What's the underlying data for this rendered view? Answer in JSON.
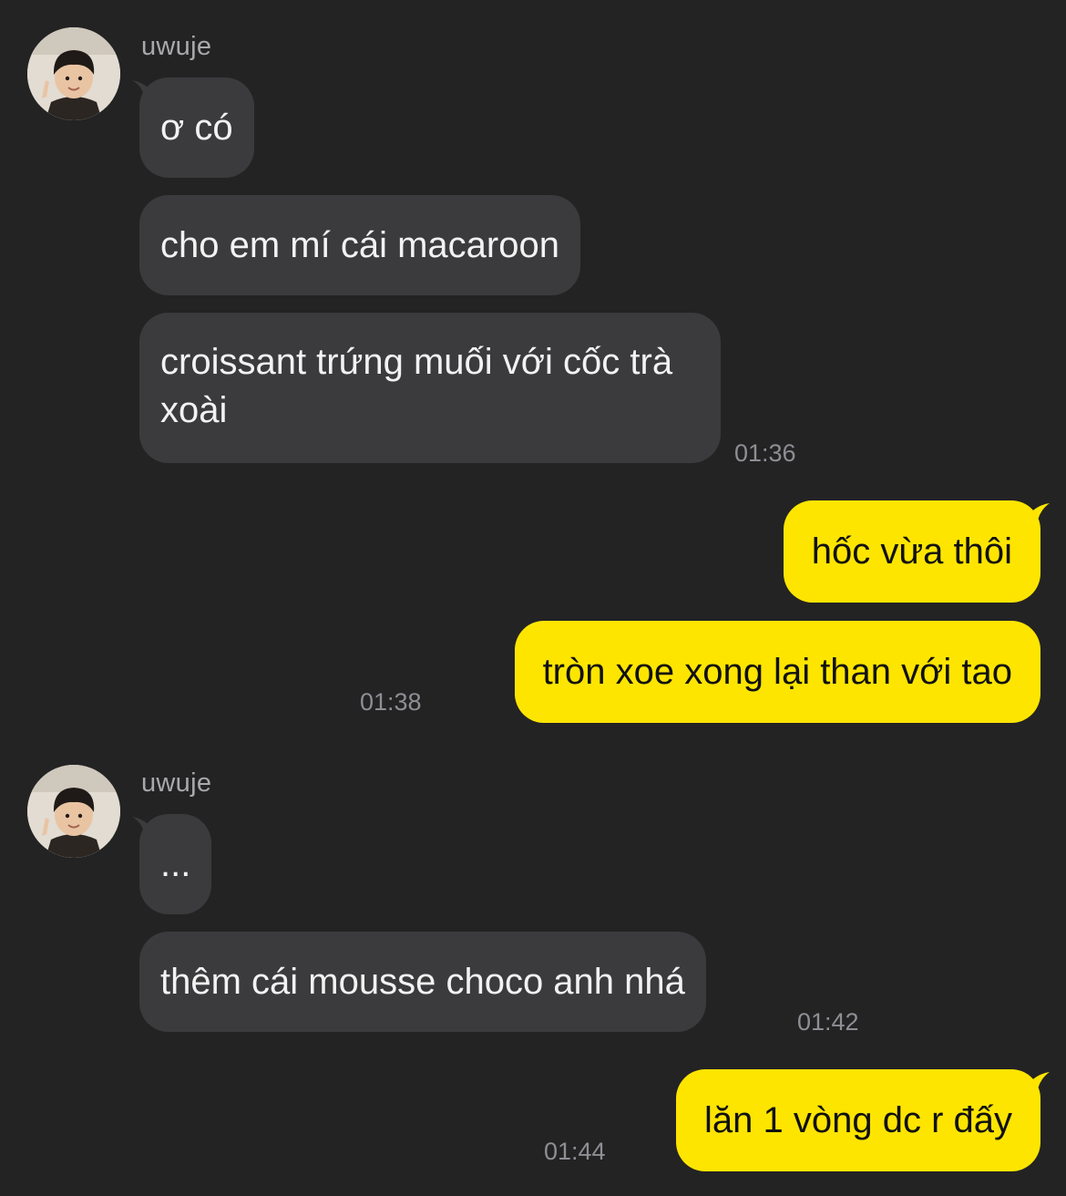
{
  "chat": {
    "colors": {
      "background": "#232324",
      "incoming_bubble": "#3b3b3d",
      "outgoing_bubble": "#fee500",
      "incoming_text": "#f2f2f2",
      "outgoing_text": "#111111",
      "sender_name": "#a9a9ad",
      "timestamp": "#8e8e93"
    },
    "groups": [
      {
        "sender": "uwuje",
        "avatar": "avatar-photo-icon",
        "messages": [
          "ơ có",
          "cho em mí cái macaroon",
          "croissant trứng muối với cốc trà xoài"
        ],
        "time": "01:36"
      },
      {
        "sender": "me",
        "messages": [
          "hốc vừa thôi",
          "tròn xoe xong lại than với tao"
        ],
        "time": "01:38"
      },
      {
        "sender": "uwuje",
        "avatar": "avatar-photo-icon",
        "messages": [
          "...",
          "thêm cái mousse choco anh nhá"
        ],
        "time": "01:42"
      },
      {
        "sender": "me",
        "messages": [
          "lăn 1 vòng dc r đấy"
        ],
        "time": "01:44"
      }
    ]
  }
}
